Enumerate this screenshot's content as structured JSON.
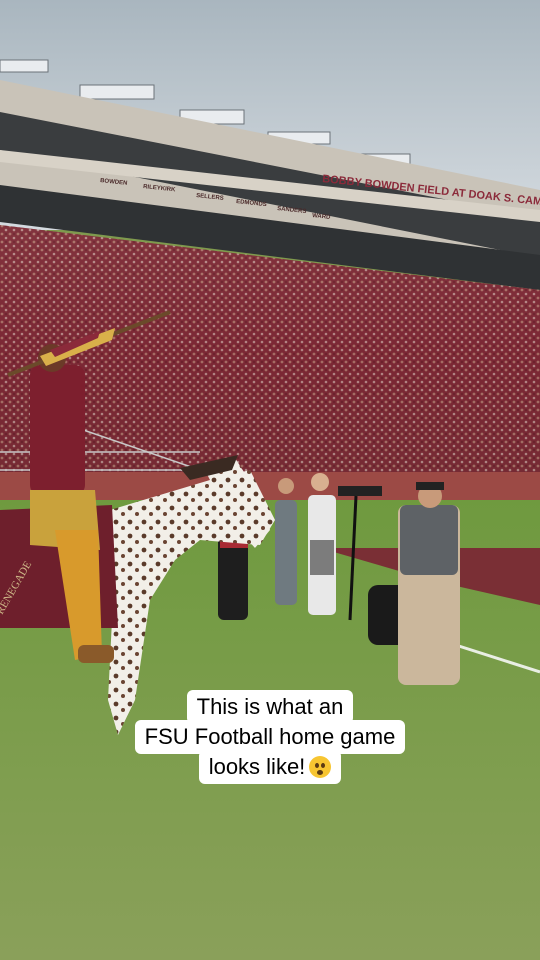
{
  "stadium": {
    "facade_sign": "BOBBY BOWDEN FIELD AT DOAK S. CAMPBELL",
    "ring_of_honor": [
      "BOWDEN",
      "RILEYKIRK",
      "SELLERS",
      "EDMONDS",
      "SANDERS",
      "WARD"
    ],
    "horse_blanket_text": "RENEGADE"
  },
  "caption": {
    "line1": "This is what an",
    "line2": "FSU Football home game",
    "line3": "looks like!"
  },
  "caption_emoji": "flushed-face-icon",
  "colors": {
    "sky": "#b9c4cc",
    "crowd": "#7a2533",
    "field": "#7f9a4e",
    "garnet": "#782f40",
    "gold": "#ceb888",
    "caption_bg": "#ffffff"
  }
}
